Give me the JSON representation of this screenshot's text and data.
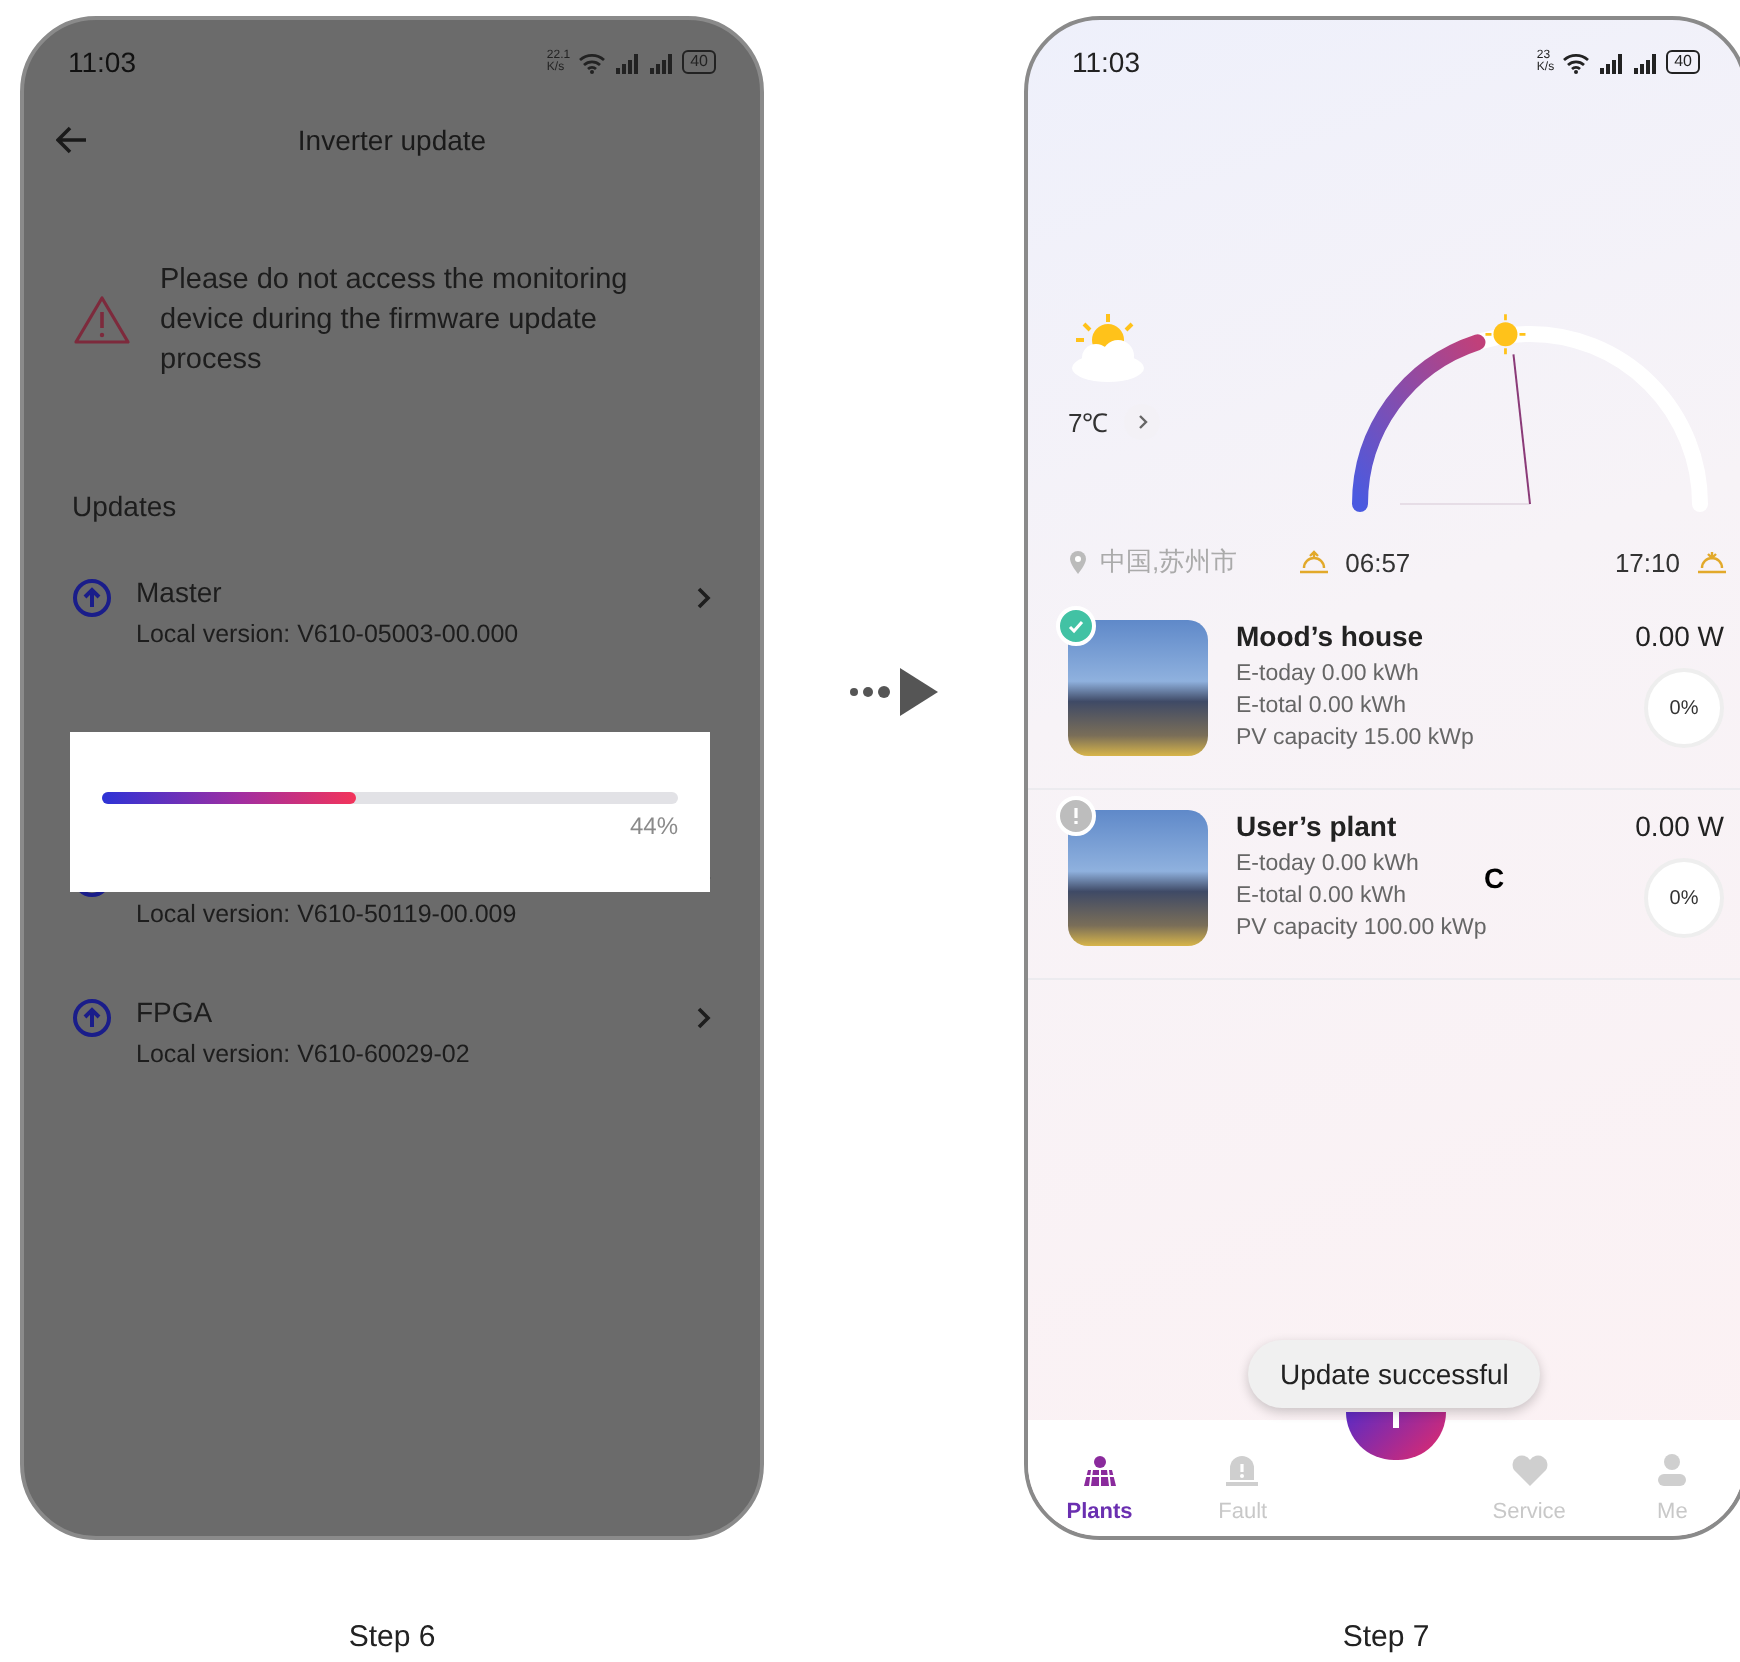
{
  "step6": {
    "status_bar": {
      "time": "11:03",
      "speed": [
        "22.1",
        "K/s"
      ],
      "battery": "40"
    },
    "title": "Inverter update",
    "warning": "Please do not access the monitoring device during the firmware update process",
    "section": "Updates",
    "updates": [
      {
        "name": "Master",
        "version": "Local version: V610-05003-00.000"
      },
      {
        "version": "Local version: V610-50119-00.009"
      },
      {
        "name": "FPGA",
        "version": "Local version: V610-60029-02"
      }
    ],
    "progress": {
      "level": 0.44,
      "reading": "44%"
    },
    "caption": "Step 6"
  },
  "step7": {
    "status_bar": {
      "time": "11:03",
      "speed": [
        "23",
        "K/s"
      ],
      "battery": "40"
    },
    "weather": {
      "temperature": "7℃",
      "location": "中国,苏州市",
      "sunrise": "06:57",
      "sunset": "17:10",
      "level": 0.4
    },
    "plants": [
      {
        "kind": "ok",
        "name": "Mood’s house",
        "power": "0.00 W",
        "e_today": "E-today 0.00 kWh",
        "e_total": "E-total 0.00 kWh",
        "capacity": "PV capacity 15.00 kWp",
        "ratio": "0%"
      },
      {
        "kind": "warning",
        "name": "User’s plant",
        "power": "0.00 W",
        "e_today": "E-today 0.00 kWh",
        "e_total": "E-total 0.00 kWh",
        "capacity": "PV capacity 100.00 kWp",
        "ratio": "0%"
      }
    ],
    "overlay_mark": "C",
    "toast": "Update successful",
    "tabs": [
      {
        "label": "Plants",
        "selected": true,
        "kind": "plants"
      },
      {
        "label": "Fault",
        "selected": false,
        "kind": "fault"
      },
      {
        "label": "Service",
        "selected": false,
        "kind": "service"
      },
      {
        "label": "Me",
        "selected": false,
        "kind": "me"
      }
    ],
    "caption": "Step 7"
  }
}
